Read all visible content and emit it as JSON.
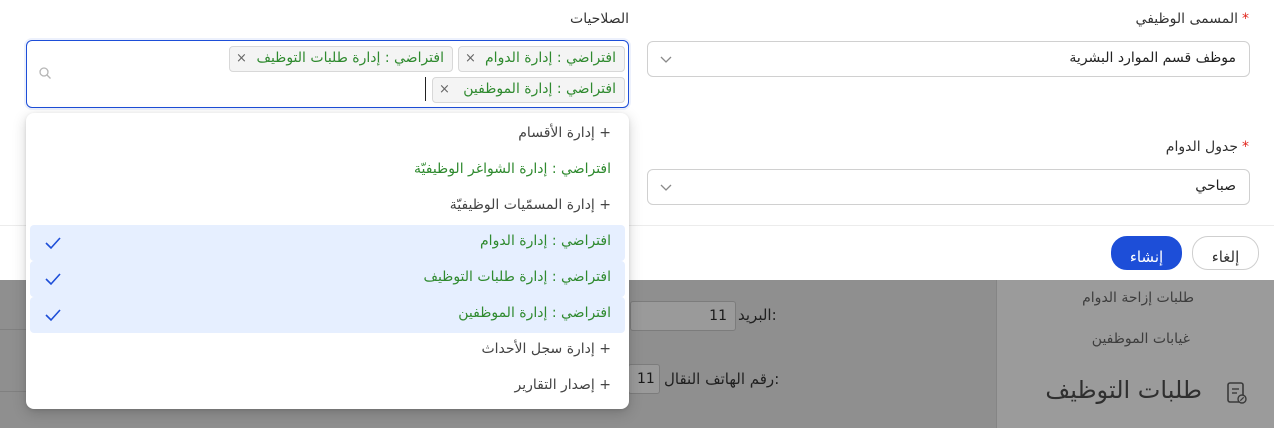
{
  "background": {
    "sidebar_items": [
      "طلبات إزاحة الدوام",
      "غيابات الموظفين"
    ],
    "sidebar_title": "طلبات التوظيف",
    "email_label": "البريد:",
    "email_value": "11",
    "mobile_label": "رقم الهاتف النقال:",
    "mobile_value": "11"
  },
  "form": {
    "job_title": {
      "label": "المسمى الوظيفي",
      "required_mark": "*",
      "value": "موظف قسم الموارد البشرية"
    },
    "permissions": {
      "label": "الصلاحيات",
      "tags": [
        "افتراضي : إدارة الدوام",
        "افتراضي : إدارة طلبات التوظيف",
        "افتراضي : إدارة الموظفين"
      ],
      "remove_glyph": "×"
    },
    "schedule": {
      "label": "جدول الدوام",
      "required_mark": "*",
      "value": "صباحي"
    }
  },
  "buttons": {
    "create": "إنشاء",
    "cancel": "إلغاء"
  },
  "dropdown": {
    "options": [
      {
        "label": "+ إدارة الأقسام",
        "kind": "new",
        "selected": false
      },
      {
        "label": "افتراضي : إدارة الشواغر الوظيفيّة",
        "kind": "default",
        "selected": false
      },
      {
        "label": "+ إدارة المسمّيات الوظيفيّة",
        "kind": "new",
        "selected": false
      },
      {
        "label": "افتراضي : إدارة الدوام",
        "kind": "default",
        "selected": true
      },
      {
        "label": "افتراضي : إدارة طلبات التوظيف",
        "kind": "default",
        "selected": true
      },
      {
        "label": "افتراضي : إدارة الموظفين",
        "kind": "default",
        "selected": true
      },
      {
        "label": "+ إدارة سجل الأحداث",
        "kind": "new",
        "selected": false
      },
      {
        "label": "+ إصدار التقارير",
        "kind": "new",
        "selected": false
      }
    ]
  },
  "colors": {
    "primary": "#1d4ed8",
    "default_option_text": "#2f8a2f",
    "selected_option_bg": "#e6efff",
    "required": "#e1251b"
  }
}
